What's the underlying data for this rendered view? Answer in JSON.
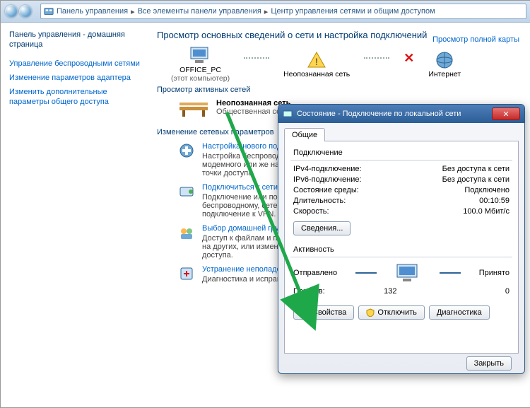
{
  "breadcrumb": {
    "items": [
      "Панель управления",
      "Все элементы панели управления",
      "Центр управления сетями и общим доступом"
    ]
  },
  "sidebar": {
    "home": "Панель управления - домашняя страница",
    "links": [
      "Управление беспроводными сетями",
      "Изменение параметров адаптера",
      "Изменить дополнительные параметры общего доступа"
    ]
  },
  "main": {
    "title": "Просмотр основных сведений о сети и настройка подключений",
    "mapLink": "Просмотр полной карты",
    "nodes": {
      "pc": "OFFICE_PC",
      "pcSub": "(этот компьютер)",
      "unknown": "Неопознанная сеть",
      "internet": "Интернет"
    },
    "activeHeader": "Просмотр активных сетей",
    "activeNet": {
      "name": "Неопознанная сеть",
      "type": "Общественная сеть"
    },
    "paramsHeader": "Изменение сетевых параметров",
    "params": [
      {
        "title": "Настройка нового подключения",
        "desc": "Настройка беспроводного, широкополосного, модемного или же настройка маршрутизатора или точки доступа."
      },
      {
        "title": "Подключиться к сети",
        "desc": "Подключение или повторное подключение к беспроводному, сетевому соединению или подключение к VPN."
      },
      {
        "title": "Выбор домашней группы и параметров",
        "desc": "Доступ к файлам и принтерам, расположенным на других, или изменение параметров общего доступа."
      },
      {
        "title": "Устранение неполадок",
        "desc": "Диагностика и исправление сетевых проблем."
      }
    ]
  },
  "dlg": {
    "title": "Состояние - Подключение по локальной сети",
    "tab": "Общие",
    "connGroup": "Подключение",
    "conn": {
      "ipv4_l": "IPv4-подключение:",
      "ipv4_v": "Без доступа к сети",
      "ipv6_l": "IPv6-подключение:",
      "ipv6_v": "Без доступа к сети",
      "media_l": "Состояние среды:",
      "media_v": "Подключено",
      "dur_l": "Длительность:",
      "dur_v": "00:10:59",
      "speed_l": "Скорость:",
      "speed_v": "100.0 Мбит/с"
    },
    "detailsBtn": "Сведения...",
    "activityGroup": "Активность",
    "sent": "Отправлено",
    "recv": "Принято",
    "pkt_l": "Пакетов:",
    "pkt_sent": "132",
    "pkt_recv": "0",
    "btns": {
      "props": "Свойства",
      "disable": "Отключить",
      "diag": "Диагностика",
      "close": "Закрыть"
    }
  }
}
